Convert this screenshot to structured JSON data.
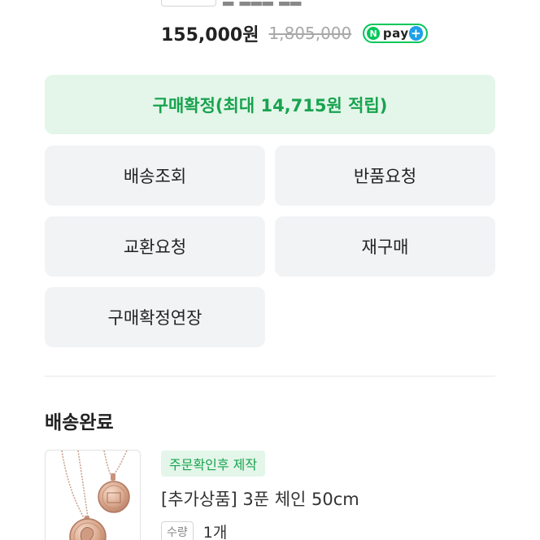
{
  "price": {
    "current": "155,000원",
    "original": "1,805,000",
    "npay_n": "N",
    "npay_text": "pay",
    "npay_plus": "+"
  },
  "actions": {
    "confirm": "구매확정(최대 14,715원 적립)",
    "track_delivery": "배송조회",
    "return_request": "반품요청",
    "exchange_request": "교환요청",
    "reorder": "재구매",
    "extend_confirm": "구매확정연장"
  },
  "delivery": {
    "status_title": "배송완료",
    "item": {
      "badge": "주문확인후 제작",
      "name": "[추가상품] 3푼 체인 50cm",
      "qty_label": "수량",
      "qty_value": "1개"
    }
  },
  "colors": {
    "accent_green": "#18a34f",
    "confirm_bg": "#e3f6e9",
    "button_bg": "#f2f3f5",
    "npay_green": "#03c75a"
  }
}
